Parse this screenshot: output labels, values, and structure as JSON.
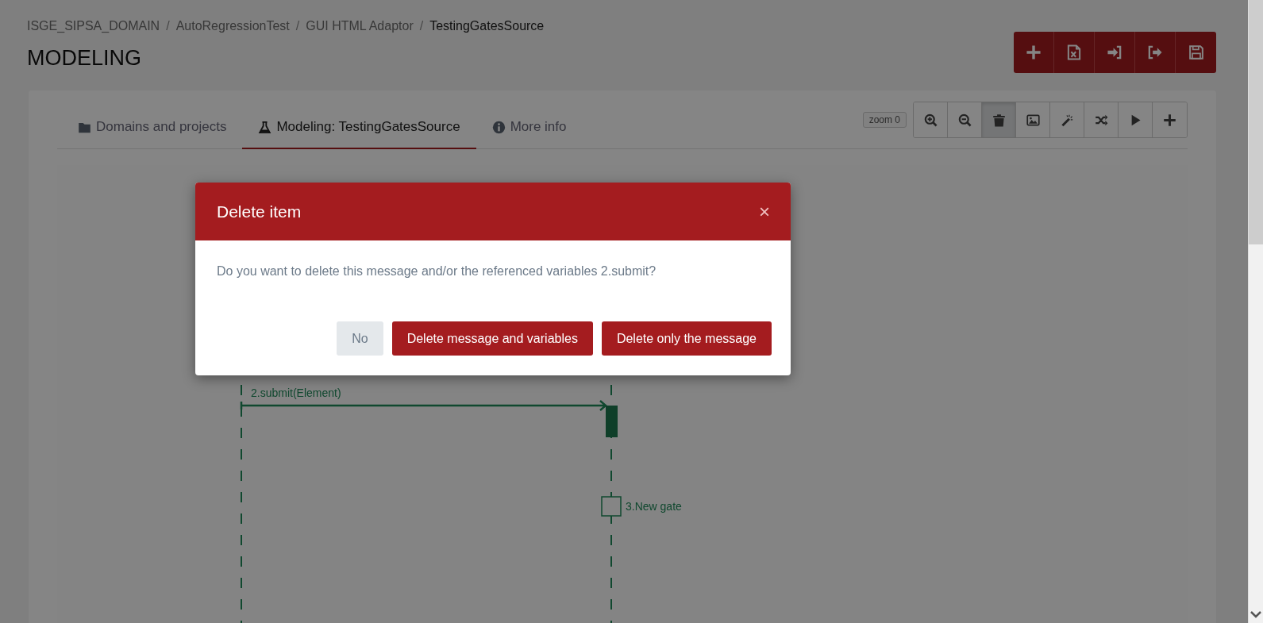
{
  "breadcrumb": [
    {
      "label": "ISGE_SIPSA_DOMAIN",
      "current": false
    },
    {
      "separator": "/",
      "label": "AutoRegressionTest",
      "current": false
    },
    {
      "separator": "/",
      "label": "GUI HTML Adaptor",
      "current": false
    },
    {
      "separator": "/",
      "label": "TestingGatesSource",
      "current": true
    }
  ],
  "page_title": "MODELING",
  "header_actions": [
    {
      "kind": "plus"
    },
    {
      "kind": "excel"
    },
    {
      "kind": "import"
    },
    {
      "kind": "export"
    },
    {
      "kind": "save"
    }
  ],
  "tabs": [
    {
      "label": "Domains and projects",
      "selected": false
    },
    {
      "label": "Modeling: TestingGatesSource",
      "selected": true
    },
    {
      "label": "More info",
      "selected": false
    }
  ],
  "zoom_badge": "zoom 0",
  "tools": [
    {
      "kind": "zoom-in",
      "selected": false
    },
    {
      "kind": "zoom-out",
      "selected": false
    },
    {
      "kind": "trash",
      "selected": true
    },
    {
      "kind": "image",
      "selected": false
    },
    {
      "kind": "wand",
      "selected": false
    },
    {
      "kind": "shuffle",
      "selected": false
    },
    {
      "kind": "play",
      "selected": false
    },
    {
      "kind": "plus",
      "selected": false
    }
  ],
  "diagram": {
    "messages": [
      {
        "label": "2.submit(Element)"
      }
    ],
    "gates": [
      {
        "label": "3.New gate"
      }
    ]
  },
  "dialog": {
    "title": "Delete item",
    "close": "×",
    "message": "Do you want to delete this message and/or the referenced variables 2.submit?",
    "buttons": [
      {
        "label": "No",
        "kind": "secondary"
      },
      {
        "label": "Delete message and variables",
        "kind": "primary"
      },
      {
        "label": "Delete only the message",
        "kind": "primary"
      }
    ]
  }
}
